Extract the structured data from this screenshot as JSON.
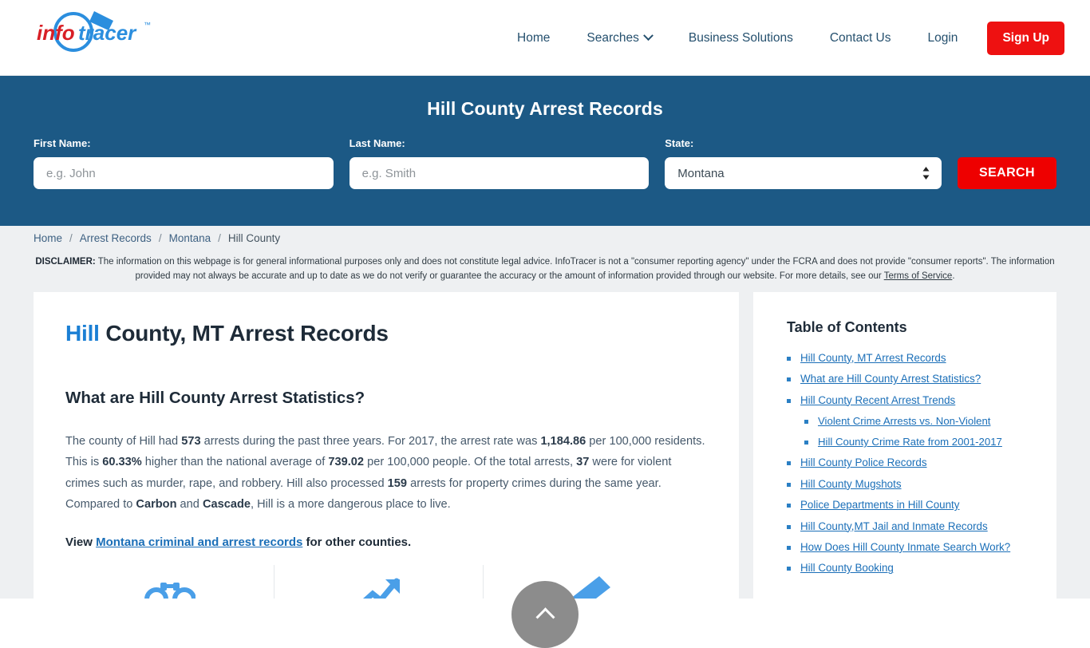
{
  "header": {
    "logo_text": "infotracer",
    "logo_tm": "™",
    "nav": [
      {
        "label": "Home",
        "icon": null
      },
      {
        "label": "Searches",
        "icon": "chevron-down-icon"
      },
      {
        "label": "Business Solutions",
        "icon": null
      },
      {
        "label": "Contact Us",
        "icon": null
      },
      {
        "label": "Login",
        "icon": null
      }
    ],
    "signup_label": "Sign Up"
  },
  "banner": {
    "title": "Hill County Arrest Records",
    "first_name_label": "First Name:",
    "first_name_placeholder": "e.g. John",
    "first_name_value": "",
    "last_name_label": "Last Name:",
    "last_name_placeholder": "e.g. Smith",
    "last_name_value": "",
    "state_label": "State:",
    "state_value": "Montana",
    "state_options": [
      "Montana"
    ],
    "search_label": "SEARCH",
    "bg_color": "#1c5985",
    "button_color": "#ee0000"
  },
  "breadcrumb": {
    "items": [
      "Home",
      "Arrest Records",
      "Montana",
      "Hill County"
    ],
    "separator": "/"
  },
  "disclaimer": {
    "label": "DISCLAIMER:",
    "text_part1": " The information on this webpage is for general informational purposes only and does not constitute legal advice. InfoTracer is not a \"consumer reporting agency\" under the FCRA and does not provide \"consumer reports\". The information provided may not always be accurate and up to date as we do not verify or guarantee the accuracy or the amount of information provided through our website. For more details, see our ",
    "link_text": "Terms of Service",
    "text_part2": "."
  },
  "main": {
    "h1_highlight": "Hill",
    "h1_rest": " County, MT Arrest Records",
    "h2": "What are Hill County Arrest Statistics?",
    "paragraph": {
      "s1": "The county of Hill had ",
      "arrests_total": "573",
      "s2": " arrests during the past three years. For 2017, the arrest rate was ",
      "arrest_rate": "1,184.86",
      "s3": " per 100,000 residents. This is ",
      "pct_higher": "60.33%",
      "s4": " higher than the national average of ",
      "national_avg": "739.02",
      "s5": " per 100,000 people. Of the total arrests, ",
      "violent_arrests": "37",
      "s6": " were for violent crimes such as murder, rape, and robbery. Hill also processed ",
      "property_arrests": "159",
      "s7": " arrests for property crimes during the same year. Compared to ",
      "compare_county_1": "Carbon",
      "s8": " and ",
      "compare_county_2": "Cascade",
      "s9": ", Hill is a more dangerous place to live."
    },
    "view_prefix": "View ",
    "view_link": "Montana criminal and arrest records",
    "view_suffix": " for other counties.",
    "icons": [
      "handcuffs-icon",
      "trend-arrow-icon",
      "pen-icon"
    ]
  },
  "toc": {
    "title": "Table of Contents",
    "items": [
      {
        "label": "Hill County, MT Arrest Records",
        "sub": false
      },
      {
        "label": "What are Hill County Arrest Statistics?",
        "sub": false
      },
      {
        "label": "Hill County Recent Arrest Trends",
        "sub": false
      },
      {
        "label": "Violent Crime Arrests vs. Non-Violent",
        "sub": true
      },
      {
        "label": "Hill County Crime Rate from 2001-2017",
        "sub": true
      },
      {
        "label": "Hill County Police Records",
        "sub": false
      },
      {
        "label": "Hill County Mugshots",
        "sub": false
      },
      {
        "label": "Police Departments in Hill County",
        "sub": false
      },
      {
        "label": "Hill County,MT Jail and Inmate Records",
        "sub": false
      },
      {
        "label": "How Does Hill County Inmate Search Work?",
        "sub": false
      },
      {
        "label": "Hill County Booking",
        "sub": false
      }
    ]
  },
  "scroll_top": {
    "icon": "chevron-up-icon"
  }
}
